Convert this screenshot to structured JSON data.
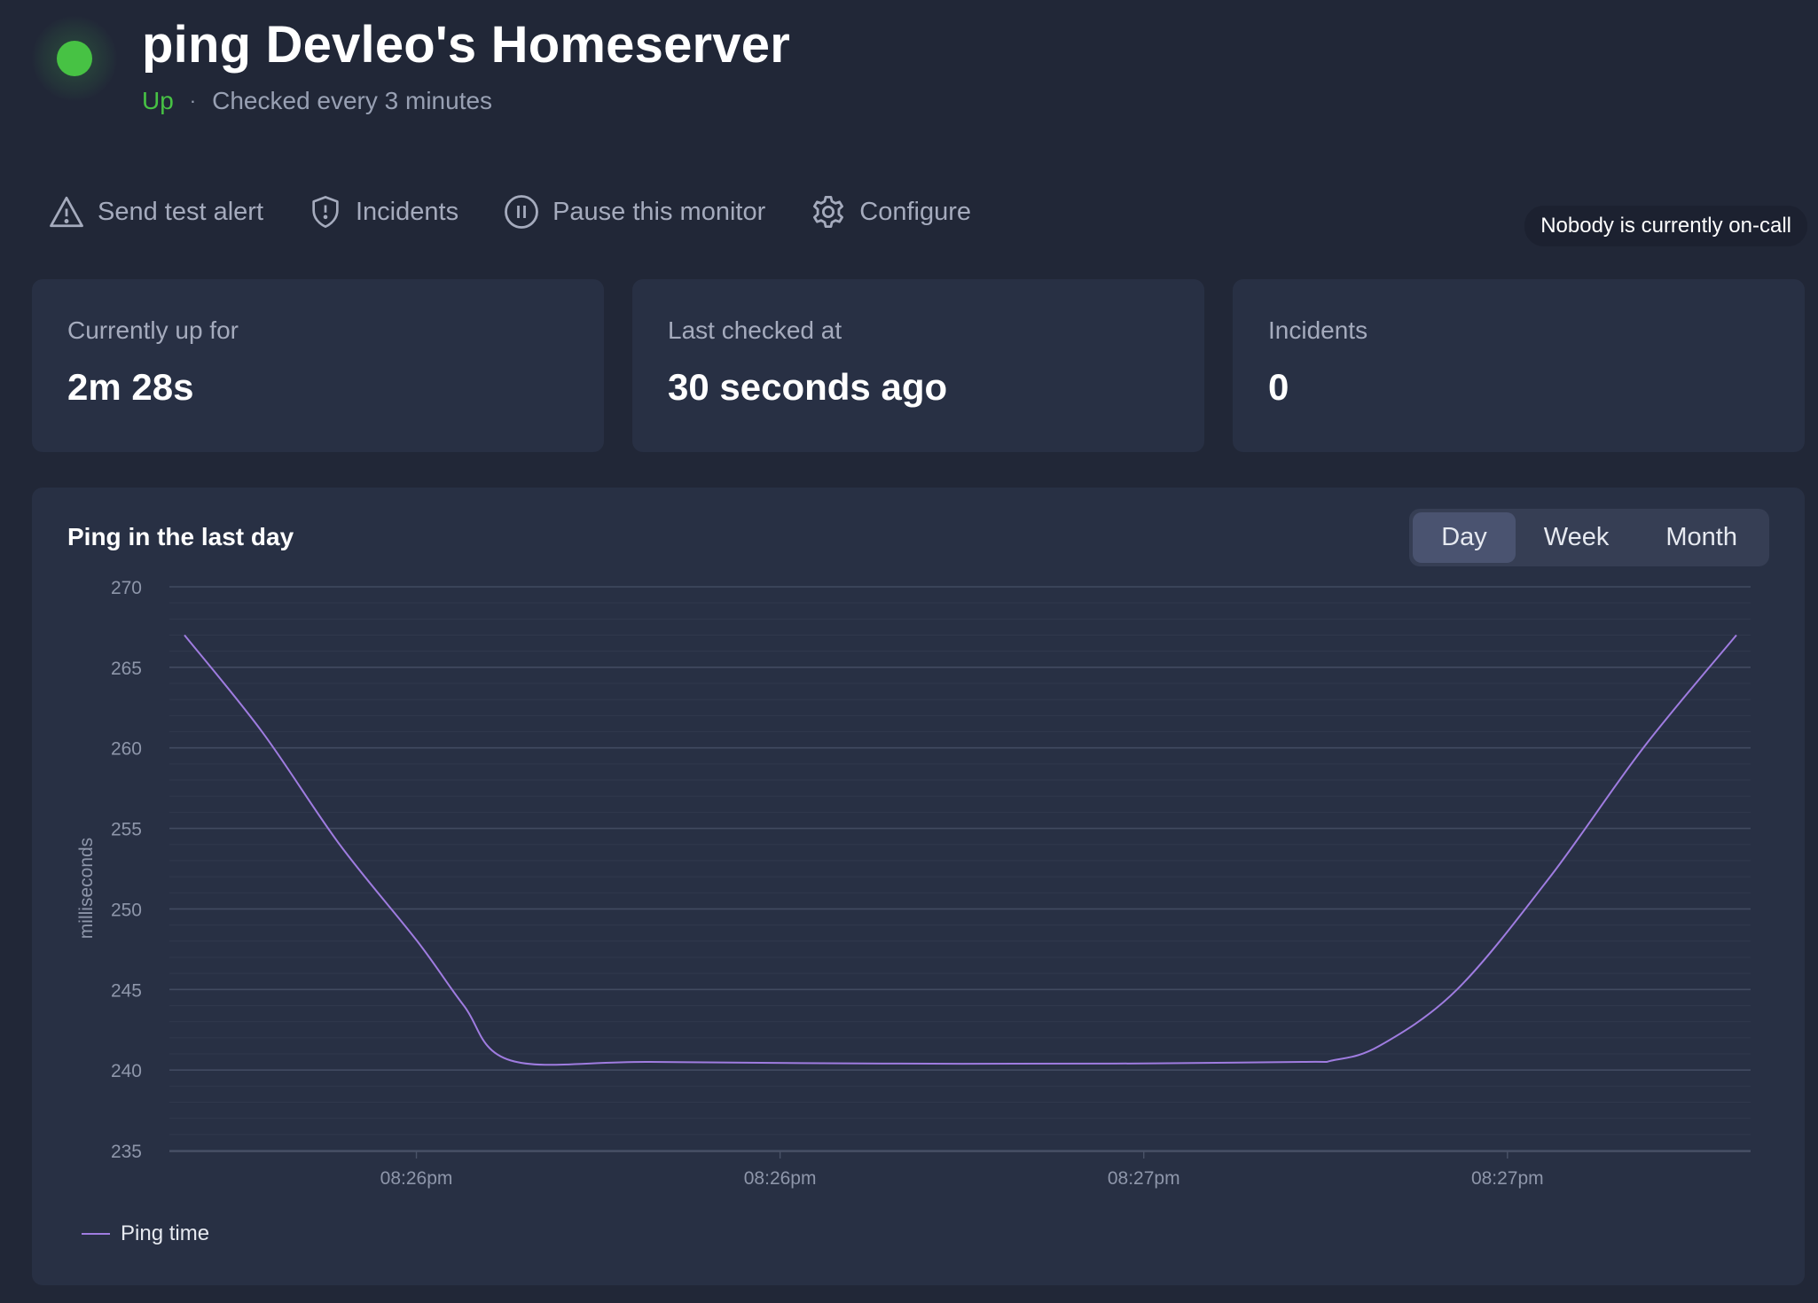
{
  "header": {
    "title": "ping Devleo's Homeserver",
    "status": "Up",
    "separator": "·",
    "check_interval": "Checked every 3 minutes",
    "status_color": "#47c244"
  },
  "toolbar": {
    "send_test_alert": "Send test alert",
    "incidents": "Incidents",
    "pause": "Pause this monitor",
    "configure": "Configure"
  },
  "oncall": "Nobody is currently on-call",
  "cards": [
    {
      "label": "Currently up for",
      "value": "2m 28s"
    },
    {
      "label": "Last checked at",
      "value": "30 seconds ago"
    },
    {
      "label": "Incidents",
      "value": "0"
    }
  ],
  "chart": {
    "title": "Ping in the last day",
    "ranges": [
      "Day",
      "Week",
      "Month"
    ],
    "selected_range": "Day",
    "legend_label": "Ping time",
    "line_color": "#9f7ce0"
  },
  "chart_data": {
    "type": "line",
    "ylabel": "milliseconds",
    "xlabel": "",
    "ylim": [
      235,
      270
    ],
    "yticks": [
      235,
      240,
      245,
      250,
      255,
      260,
      265,
      270
    ],
    "xticks": [
      "08:26pm",
      "08:26pm",
      "08:27pm",
      "08:27pm"
    ],
    "grid": true,
    "series": [
      {
        "name": "Ping time",
        "x": [
          0,
          0.05,
          0.1,
          0.15,
          0.18,
          0.21,
          0.3,
          0.45,
          0.6,
          0.72,
          0.74,
          0.77,
          0.82,
          0.88,
          0.94,
          1.0
        ],
        "values": [
          267,
          261,
          254,
          248,
          244,
          240.6,
          240.5,
          240.4,
          240.4,
          240.5,
          240.6,
          241.5,
          245,
          252,
          260,
          267
        ]
      }
    ]
  }
}
